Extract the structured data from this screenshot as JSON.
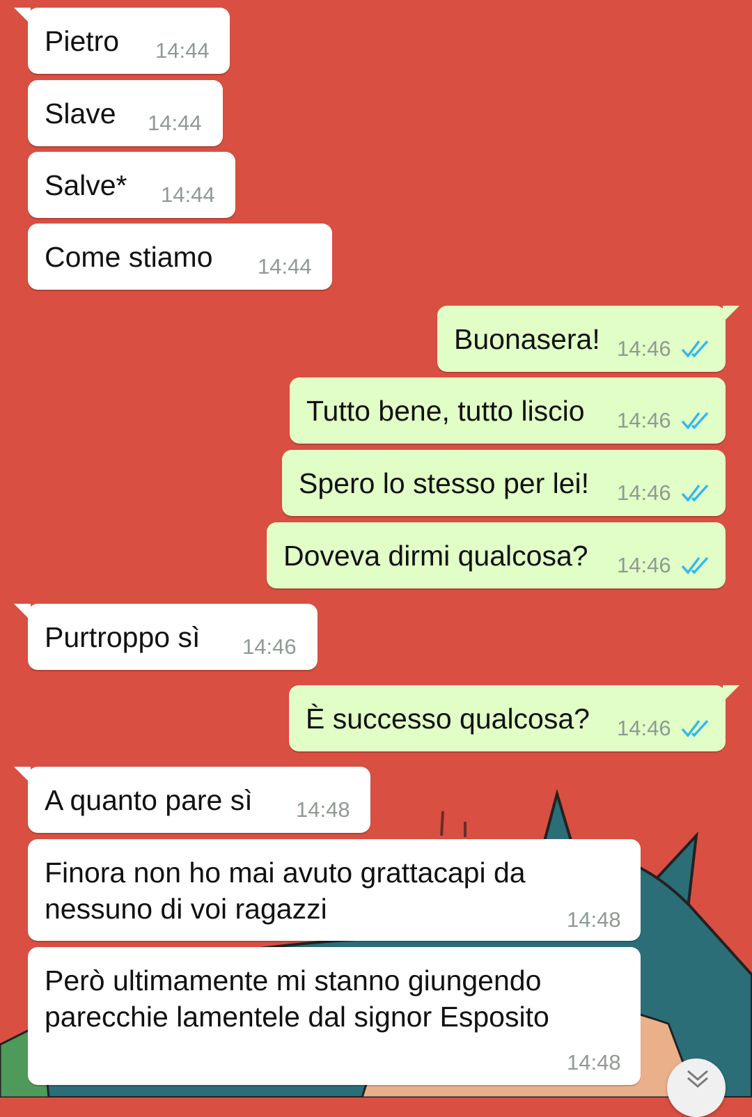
{
  "colors": {
    "background": "#d94f41",
    "incoming_bubble": "#ffffff",
    "outgoing_bubble": "#e1fec6",
    "read_ticks": "#34b7f1",
    "timestamp": "#8f9a93"
  },
  "messages": [
    {
      "direction": "incoming",
      "text": "Pietro",
      "time": "14:44"
    },
    {
      "direction": "incoming",
      "text": "Slave",
      "time": "14:44"
    },
    {
      "direction": "incoming",
      "text": "Salve*",
      "time": "14:44"
    },
    {
      "direction": "incoming",
      "text": "Come stiamo",
      "time": "14:44"
    },
    {
      "direction": "outgoing",
      "text": "Buonasera!",
      "time": "14:46",
      "status_icon": "double-check-read-icon"
    },
    {
      "direction": "outgoing",
      "text": "Tutto bene, tutto liscio",
      "time": "14:46",
      "status_icon": "double-check-read-icon"
    },
    {
      "direction": "outgoing",
      "text": "Spero lo stesso per lei!",
      "time": "14:46",
      "status_icon": "double-check-read-icon"
    },
    {
      "direction": "outgoing",
      "text": "Doveva dirmi qualcosa?",
      "time": "14:46",
      "status_icon": "double-check-read-icon"
    },
    {
      "direction": "incoming",
      "text": "Purtroppo sì",
      "time": "14:46"
    },
    {
      "direction": "outgoing",
      "text": "È successo qualcosa?",
      "time": "14:46",
      "status_icon": "double-check-read-icon"
    },
    {
      "direction": "incoming",
      "text": "A quanto pare sì",
      "time": "14:48"
    },
    {
      "direction": "incoming",
      "text": "Finora non ho mai avuto grattacapi da nessuno di voi ragazzi",
      "time": "14:48"
    },
    {
      "direction": "incoming",
      "text": "Però ultimamente mi stanno giungendo parecchie lamentele dal signor Esposito",
      "time": "14:48"
    }
  ],
  "scroll_button_icon": "chevron-double-down-icon"
}
